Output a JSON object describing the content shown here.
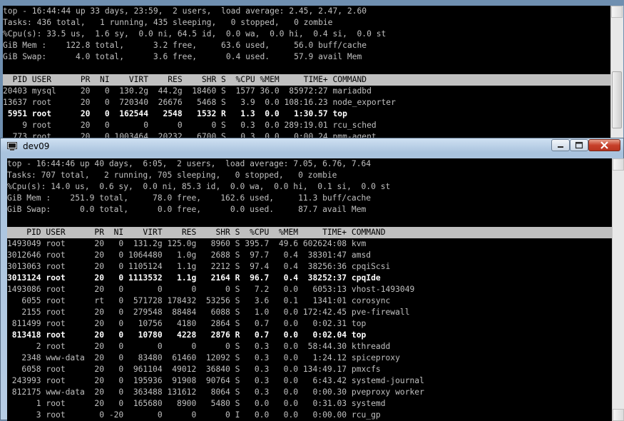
{
  "back_window": {
    "lines": [
      "top - 16:44:44 up 33 days, 23:59,  2 users,  load average: 2.45, 2.47, 2.60",
      "Tasks: 436 total,   1 running, 435 sleeping,   0 stopped,   0 zombie",
      "%Cpu(s): 33.5 us,  1.6 sy,  0.0 ni, 64.5 id,  0.0 wa,  0.0 hi,  0.4 si,  0.0 st",
      "GiB Mem :    122.8 total,      3.2 free,     63.6 used,     56.0 buff/cache",
      "GiB Swap:      4.0 total,      3.6 free,      0.4 used.     57.9 avail Mem",
      ""
    ],
    "header": "  PID USER      PR  NI    VIRT    RES    SHR S  %CPU %MEM     TIME+ COMMAND                                                                        ",
    "rows": [
      {
        "text": "20403 mysql     20   0  130.2g  44.2g  18460 S  1577 36.0  85972:27 mariadbd",
        "bold": false
      },
      {
        "text": "13637 root      20   0  720340  26676   5468 S   3.9  0.0 108:16.23 node_exporter",
        "bold": false
      },
      {
        "text": " 5951 root      20   0  162544   2548   1532 R   1.3  0.0   1:30.57 top",
        "bold": true
      },
      {
        "text": "    9 root      20   0       0      0      0 S   0.3  0.0 289:19.01 rcu_sched",
        "bold": false
      },
      {
        "text": "  773 root      20   0 1003464  20232   6700 S   0.3  0.0   0:00.24 pmm-agent",
        "bold": false
      }
    ]
  },
  "front_window": {
    "title": "dev09",
    "lines": [
      "top - 16:44:46 up 40 days,  6:05,  2 users,  load average: 7.05, 6.76, 7.64",
      "Tasks: 707 total,   2 running, 705 sleeping,   0 stopped,   0 zombie",
      "%Cpu(s): 14.0 us,  0.6 sy,  0.0 ni, 85.3 id,  0.0 wa,  0.0 hi,  0.1 si,  0.0 st",
      "GiB Mem :    251.9 total,     78.0 free,    162.6 used,     11.3 buff/cache",
      "GiB Swap:      0.0 total,      0.0 free,      0.0 used.     87.7 avail Mem",
      ""
    ],
    "header": "    PID USER      PR  NI    VIRT    RES    SHR S  %CPU  %MEM     TIME+ COMMAND                                                                      ",
    "rows": [
      {
        "text": "1493049 root      20   0  131.2g 125.0g   8960 S 395.7  49.6 602624:08 kvm",
        "bold": false
      },
      {
        "text": "3012646 root      20   0 1064480   1.0g   2688 S  97.7   0.4  38301:47 amsd",
        "bold": false
      },
      {
        "text": "3013063 root      20   0 1105124   1.1g   2212 S  97.4   0.4  38256:36 cpqiScsi",
        "bold": false
      },
      {
        "text": "3013124 root      20   0 1113532   1.1g   2164 R  96.7   0.4  38252:37 cpqIde",
        "bold": true
      },
      {
        "text": "1493086 root      20   0       0      0      0 S   7.2   0.0   6053:13 vhost-1493049",
        "bold": false
      },
      {
        "text": "   6055 root      rt   0  571728 178432  53256 S   3.6   0.1   1341:01 corosync",
        "bold": false
      },
      {
        "text": "   2155 root      20   0  279548  88484   6088 S   1.0   0.0 172:42.45 pve-firewall",
        "bold": false
      },
      {
        "text": " 811499 root      20   0   10756   4180   2864 S   0.7   0.0   0:02.31 top",
        "bold": false
      },
      {
        "text": " 813418 root      20   0   10780   4228   2876 R   0.7   0.0   0:02.04 top",
        "bold": true
      },
      {
        "text": "      2 root      20   0       0      0      0 S   0.3   0.0  58:44.30 kthreadd",
        "bold": false
      },
      {
        "text": "   2348 www-data  20   0   83480  61460  12092 S   0.3   0.0   1:24.12 spiceproxy",
        "bold": false
      },
      {
        "text": "   6058 root      20   0  961104  49012  36840 S   0.3   0.0 134:49.17 pmxcfs",
        "bold": false
      },
      {
        "text": " 243993 root      20   0  195936  91908  90764 S   0.3   0.0   6:43.42 systemd-journal",
        "bold": false
      },
      {
        "text": " 812175 www-data  20   0  363488 131612   8064 S   0.3   0.0   0:00.30 pveproxy worker",
        "bold": false
      },
      {
        "text": "      1 root      20   0  165680   8900   5480 S   0.0   0.0   0:31.03 systemd",
        "bold": false
      },
      {
        "text": "      3 root       0 -20       0      0      0 I   0.0   0.0   0:00.00 rcu_gp",
        "bold": false
      }
    ]
  },
  "icons": {
    "title_icon": "putty-terminal-icon",
    "minimize": "minimize-icon",
    "maximize": "maximize-icon",
    "close": "close-icon"
  },
  "colors": {
    "terminal_bg": "#000000",
    "terminal_fg": "#c0c0c0",
    "bold_fg": "#ffffff",
    "header_bg": "#c0c0c0",
    "close_button": "#c7402a"
  }
}
